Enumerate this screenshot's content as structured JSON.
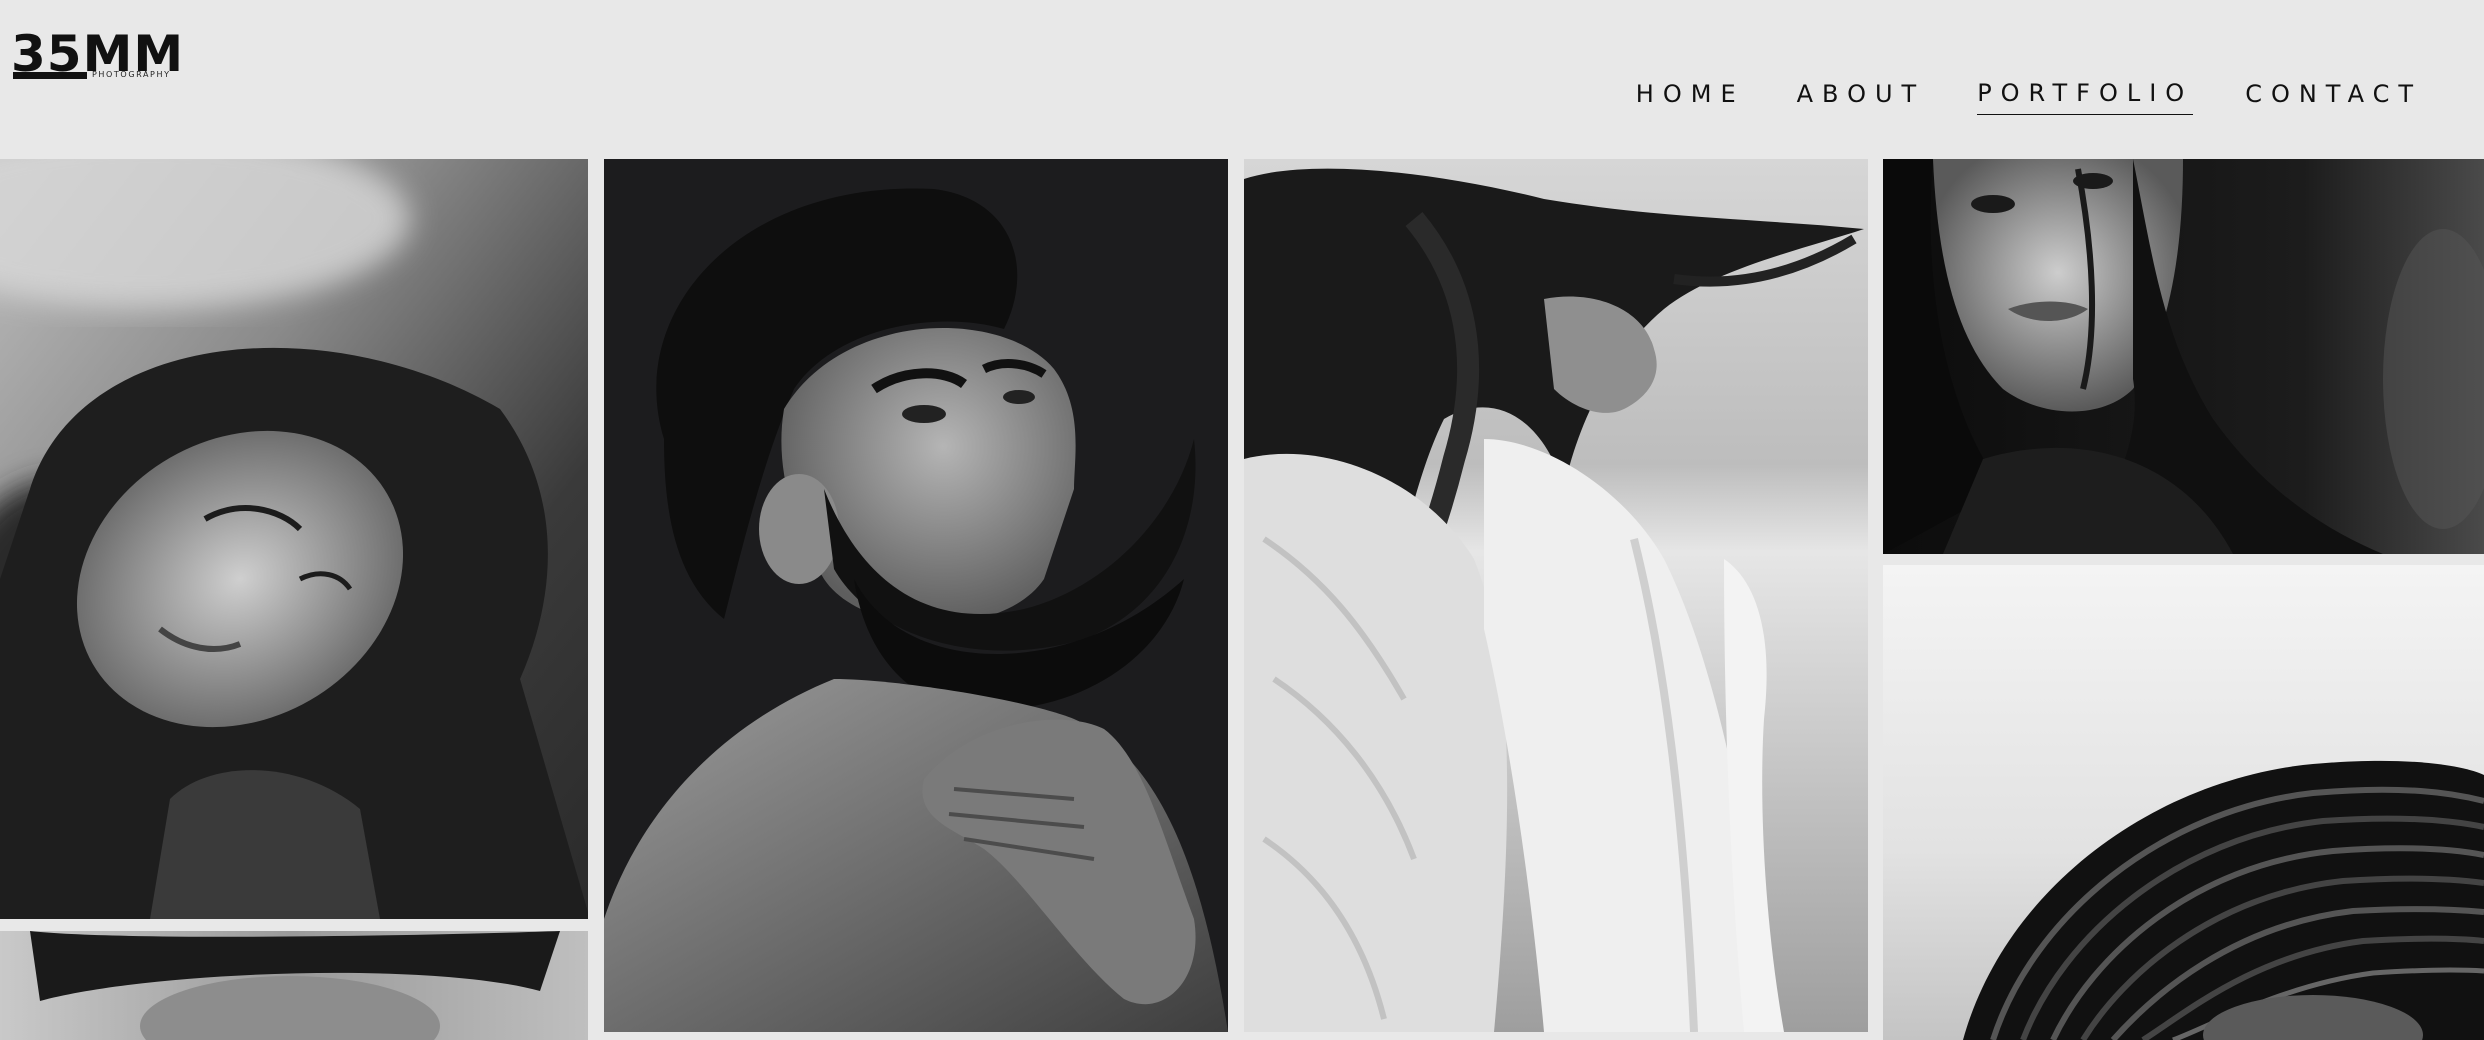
{
  "brand": {
    "logo_main": "35MM",
    "logo_sub": "PHOTOGRAPHY"
  },
  "nav": {
    "items": [
      {
        "label": "HOME",
        "active": false
      },
      {
        "label": "ABOUT",
        "active": false
      },
      {
        "label": "PORTFOLIO",
        "active": true
      },
      {
        "label": "CONTACT",
        "active": false
      }
    ]
  },
  "gallery": {
    "tone": "black-and-white",
    "photos": [
      {
        "name": "portrait-woman-curly-hair-eyes-closed"
      },
      {
        "name": "portrait-woman-curly-hair-partial"
      },
      {
        "name": "portrait-bearded-man"
      },
      {
        "name": "portrait-woman-windblown-hair-white-dress"
      },
      {
        "name": "portrait-woman-dark-hair-close-up"
      },
      {
        "name": "portrait-striped-hat"
      }
    ]
  },
  "colors": {
    "background": "#e8e8e8",
    "text": "#111111"
  }
}
